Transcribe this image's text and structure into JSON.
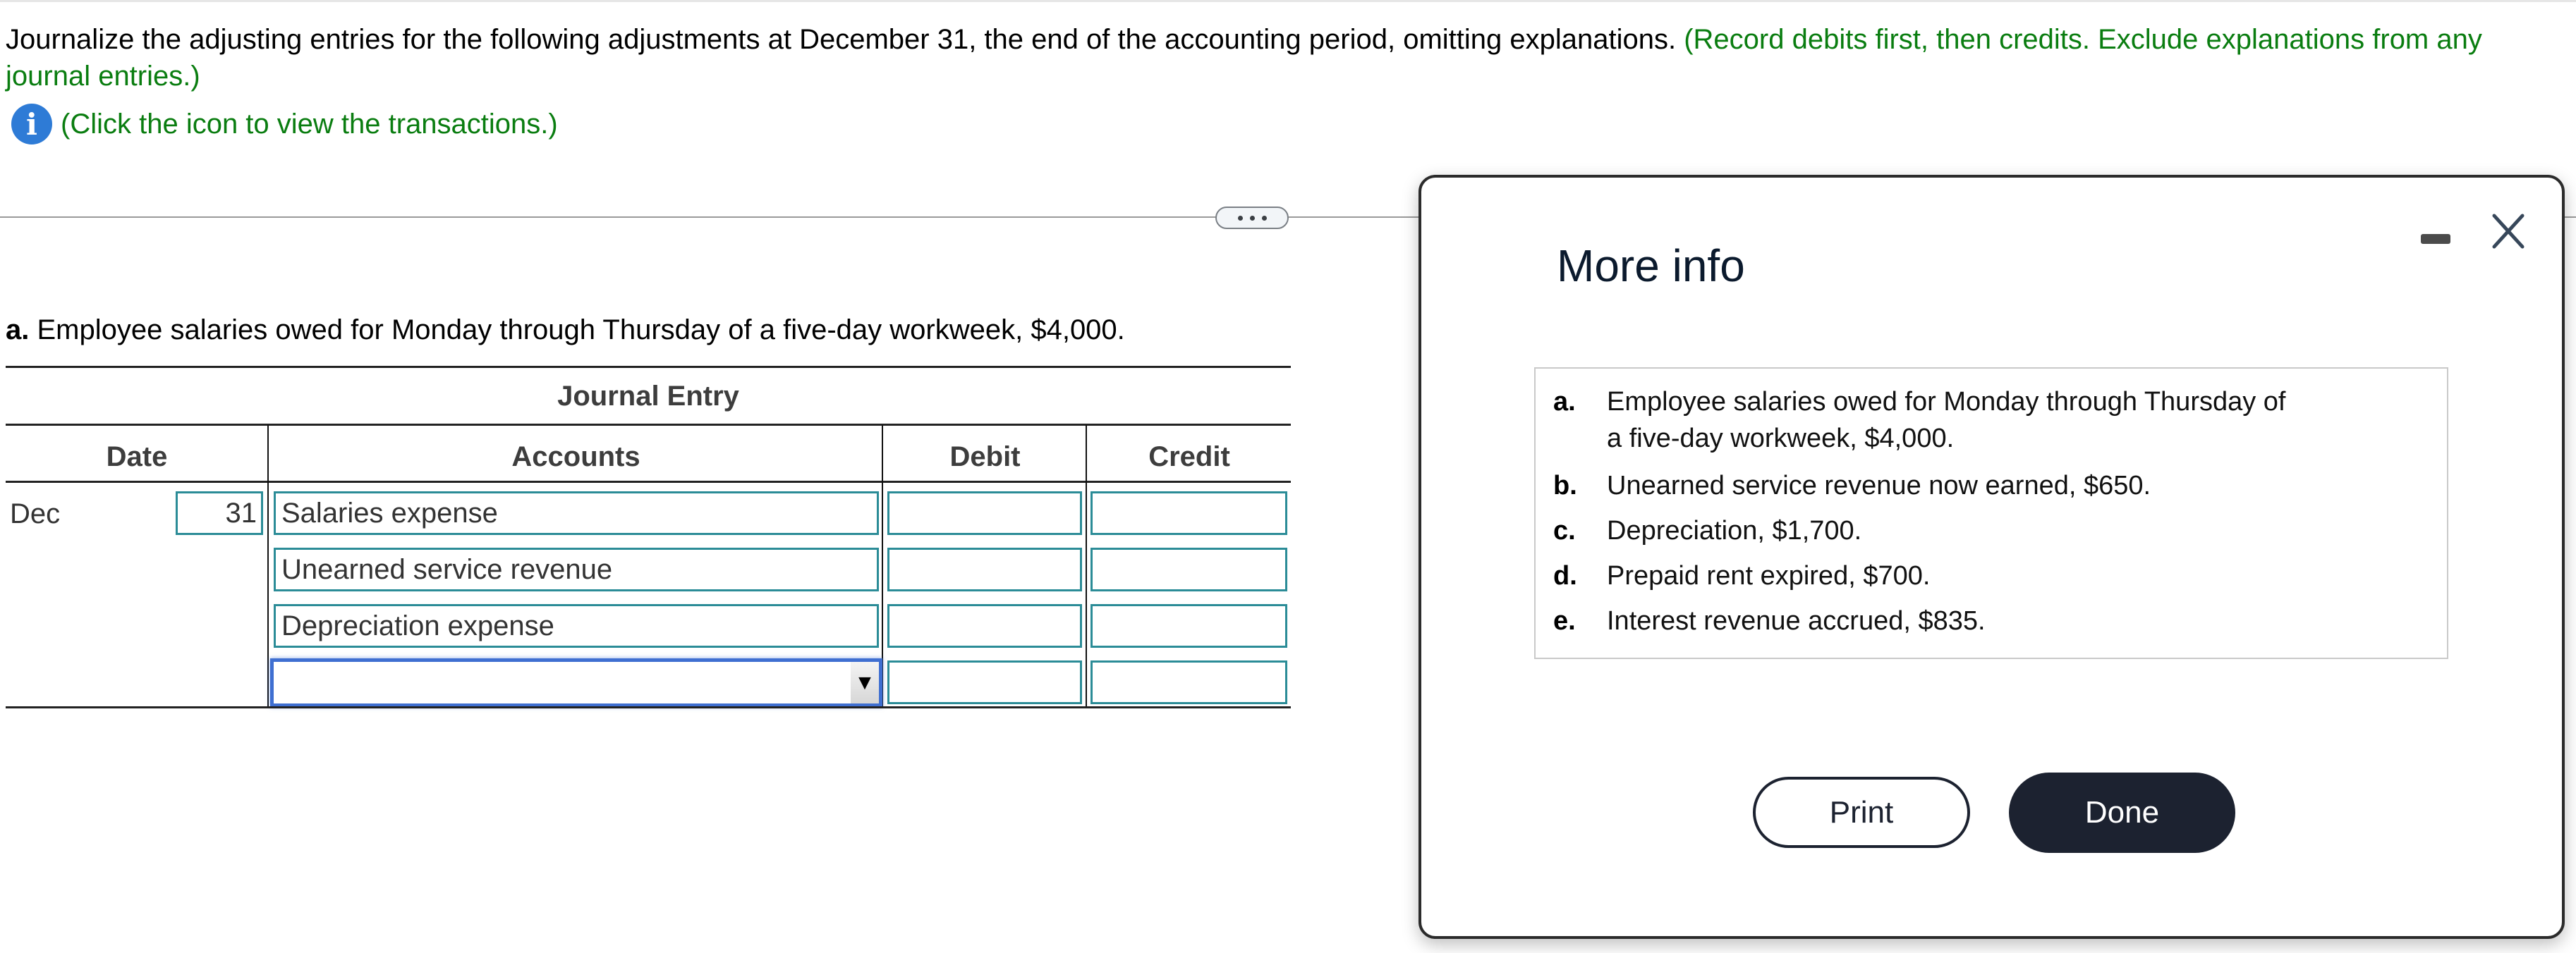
{
  "instructions": {
    "main_text": "Journalize the adjusting entries for the following adjustments at December 31, the end of the accounting period, omitting explanations.",
    "green_note": "(Record debits first, then credits. Exclude explanations from any journal entries.)",
    "info_link": "(Click the icon to view the transactions.)",
    "info_icon": "info-icon"
  },
  "divider": {
    "more_button_icon": "ellipsis-icon"
  },
  "question": {
    "label": "a.",
    "text": "Employee salaries owed for Monday through Thursday of a five-day workweek, $4,000."
  },
  "journal": {
    "title": "Journal Entry",
    "headers": {
      "date": "Date",
      "accounts": "Accounts",
      "debit": "Debit",
      "credit": "Credit"
    },
    "month": "Dec",
    "day": "31",
    "rows": [
      {
        "account": "Salaries expense",
        "debit": "",
        "credit": ""
      },
      {
        "account": "Unearned service revenue",
        "debit": "",
        "credit": ""
      },
      {
        "account": "Depreciation expense",
        "debit": "",
        "credit": ""
      },
      {
        "account": "",
        "debit": "",
        "credit": "",
        "is_dropdown": true
      }
    ]
  },
  "modal": {
    "title": "More info",
    "minimize_icon": "minimize-icon",
    "close_icon": "close-icon",
    "items": [
      {
        "label": "a.",
        "line1": "Employee salaries owed for Monday through Thursday of",
        "line2": "a five-day workweek, $4,000."
      },
      {
        "label": "b.",
        "line1": "Unearned service revenue now earned, $650."
      },
      {
        "label": "c.",
        "line1": "Depreciation, $1,700."
      },
      {
        "label": "d.",
        "line1": "Prepaid rent expired, $700."
      },
      {
        "label": "e.",
        "line1": "Interest revenue accrued, $835."
      }
    ],
    "print_label": "Print",
    "done_label": "Done"
  },
  "colors": {
    "green_text": "#0a7d10",
    "info_blue": "#2e7bd6",
    "input_border": "#2b8c97",
    "focus_blue": "#3f6fd1",
    "dark_button": "#1c2230"
  }
}
